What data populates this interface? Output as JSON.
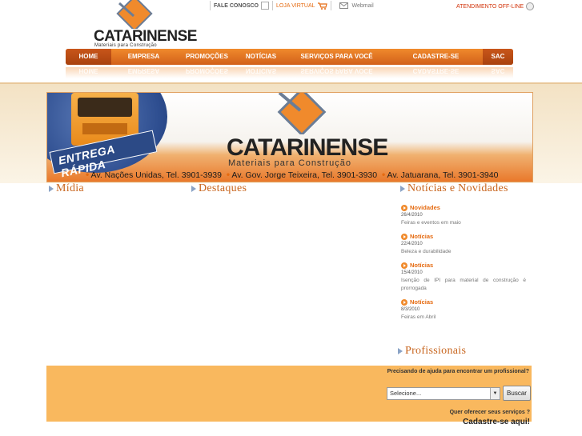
{
  "topbar": {
    "fale_conosco": "FALE CONOSCO",
    "loja_virtual": "LOJA VIRTUAL",
    "webmail": "Webmail",
    "atendimento": "ATENDIMENTO OFF-LINE"
  },
  "logo": {
    "name": "CATARINENSE",
    "tagline": "Materiais para Construção"
  },
  "nav": {
    "items": [
      "HOME",
      "EMPRESA",
      "PROMOÇÕES",
      "NOTÍCIAS",
      "SERVIÇOS PARA VOCÊ",
      "CADASTRE-SE",
      "SAC"
    ],
    "reflection": [
      "HOME",
      "EMPRESA",
      "PROMOÇÕES",
      "NOTÍCIAS",
      "SERVIÇOS PARA VOCÊ",
      "CADASTRE-SE",
      "SAC"
    ]
  },
  "banner": {
    "ribbon": "ENTREGA RÁPIDA",
    "name": "CATARINENSE",
    "tagline": "Materiais para Construção",
    "addresses": [
      "Av. Nações Unidas, Tel. 3901-3939",
      "Av. Gov. Jorge Teixeira, Tel. 3901-3930",
      "Av. Jatuarana, Tel. 3901-3940"
    ]
  },
  "sections": {
    "midia": "Mídia",
    "destaques": "Destaques",
    "noticias": "Notícias e Novidades",
    "profissionais": "Profissionais"
  },
  "news": [
    {
      "title": "Novidades",
      "date": "26/4/2010",
      "summary": "Feiras e eventos em maio"
    },
    {
      "title": "Notícias",
      "date": "22/4/2010",
      "summary": "Beleza e durabilidade"
    },
    {
      "title": "Notícias",
      "date": "15/4/2010",
      "summary": "Isenção de IPI para material de construção é prorrogada"
    },
    {
      "title": "Notícias",
      "date": "8/3/2010",
      "summary": "Feiras em Abril"
    }
  ],
  "professionals": {
    "help_text": "Precisando de ajuda para encontrar um profissional?",
    "select_value": "Selecione...",
    "search_button": "Buscar",
    "offer_text": "Quer oferecer seus serviços ?",
    "register_text": "Cadastre-se aqui!"
  },
  "colors": {
    "accent": "#e56a10",
    "nav": "#f08a2c",
    "band": "#f9b85e"
  }
}
